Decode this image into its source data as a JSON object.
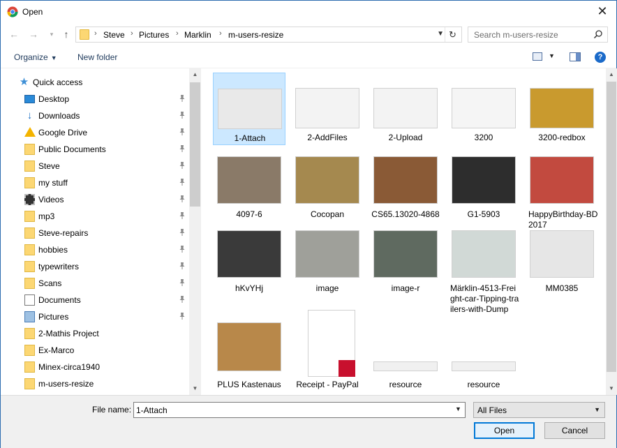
{
  "window": {
    "title": "Open"
  },
  "address": {
    "crumbs": [
      "Steve",
      "Pictures",
      "Marklin",
      "m-users-resize"
    ],
    "search_placeholder": "Search m-users-resize"
  },
  "toolbar": {
    "organize": "Organize",
    "new_folder": "New folder"
  },
  "nav": {
    "quick_access": "Quick access",
    "items": [
      {
        "label": "Desktop",
        "icon": "desktop-icon",
        "pinned": true
      },
      {
        "label": "Downloads",
        "icon": "downloads-icon",
        "pinned": true
      },
      {
        "label": "Google Drive",
        "icon": "google-drive-icon",
        "pinned": true
      },
      {
        "label": "Public Documents",
        "icon": "folder-icon",
        "pinned": true
      },
      {
        "label": "Steve",
        "icon": "folder-icon",
        "pinned": true
      },
      {
        "label": "my stuff",
        "icon": "folder-icon",
        "pinned": true
      },
      {
        "label": "Videos",
        "icon": "videos-icon",
        "pinned": true
      },
      {
        "label": "mp3",
        "icon": "folder-icon",
        "pinned": true
      },
      {
        "label": "Steve-repairs",
        "icon": "folder-icon",
        "pinned": true
      },
      {
        "label": "hobbies",
        "icon": "folder-icon",
        "pinned": true
      },
      {
        "label": "typewriters",
        "icon": "folder-icon",
        "pinned": true
      },
      {
        "label": "Scans",
        "icon": "folder-icon",
        "pinned": true
      },
      {
        "label": "Documents",
        "icon": "documents-icon",
        "pinned": true
      },
      {
        "label": "Pictures",
        "icon": "pictures-icon",
        "pinned": true
      },
      {
        "label": "2-Mathis Project",
        "icon": "folder-icon",
        "pinned": false
      },
      {
        "label": "Ex-Marco",
        "icon": "folder-icon",
        "pinned": false
      },
      {
        "label": "Minex-circa1940",
        "icon": "folder-icon",
        "pinned": false
      },
      {
        "label": "m-users-resize",
        "icon": "folder-icon",
        "pinned": false
      }
    ]
  },
  "files": [
    {
      "name": "1-Attach",
      "selected": true,
      "color": "#e9e9e9"
    },
    {
      "name": "2-AddFiles",
      "selected": false,
      "color": "#f3f3f3"
    },
    {
      "name": "2-Upload",
      "selected": false,
      "color": "#f3f3f3"
    },
    {
      "name": "3200",
      "selected": false,
      "color": "#f5f5f5"
    },
    {
      "name": "3200-redbox",
      "selected": false,
      "color": "#c99a2e"
    },
    {
      "name": "4097-6",
      "selected": false,
      "color": "#8a7a68"
    },
    {
      "name": "Cocopan",
      "selected": false,
      "color": "#a5894f"
    },
    {
      "name": "CS65.13020-4868",
      "selected": false,
      "color": "#8a5a36"
    },
    {
      "name": "G1-5903",
      "selected": false,
      "color": "#2d2d2d"
    },
    {
      "name": "HappyBirthday-BD2017",
      "selected": false,
      "color": "#c24a3f"
    },
    {
      "name": "hKvYHj",
      "selected": false,
      "color": "#3a3a3a"
    },
    {
      "name": "image",
      "selected": false,
      "color": "#9fa09a"
    },
    {
      "name": "image-r",
      "selected": false,
      "color": "#5f6a60"
    },
    {
      "name": "Märklin-4513-Freight-car-Tipping-trailers-with-Dump",
      "selected": false,
      "color": "#d1d9d6"
    },
    {
      "name": "MM0385",
      "selected": false,
      "color": "#e6e6e6"
    },
    {
      "name": "PLUS Kastenaus",
      "selected": false,
      "color": "#b8884a"
    },
    {
      "name": "Receipt - PayPal",
      "selected": false,
      "color": "#ffffff"
    },
    {
      "name": "resource",
      "selected": false,
      "color": "#f0f0f0"
    },
    {
      "name": "resource",
      "selected": false,
      "color": "#f0f0f0"
    }
  ],
  "footer": {
    "file_name_label": "File name:",
    "file_name_value": "1-Attach",
    "file_type": "All Files",
    "open_label": "Open",
    "cancel_label": "Cancel"
  }
}
